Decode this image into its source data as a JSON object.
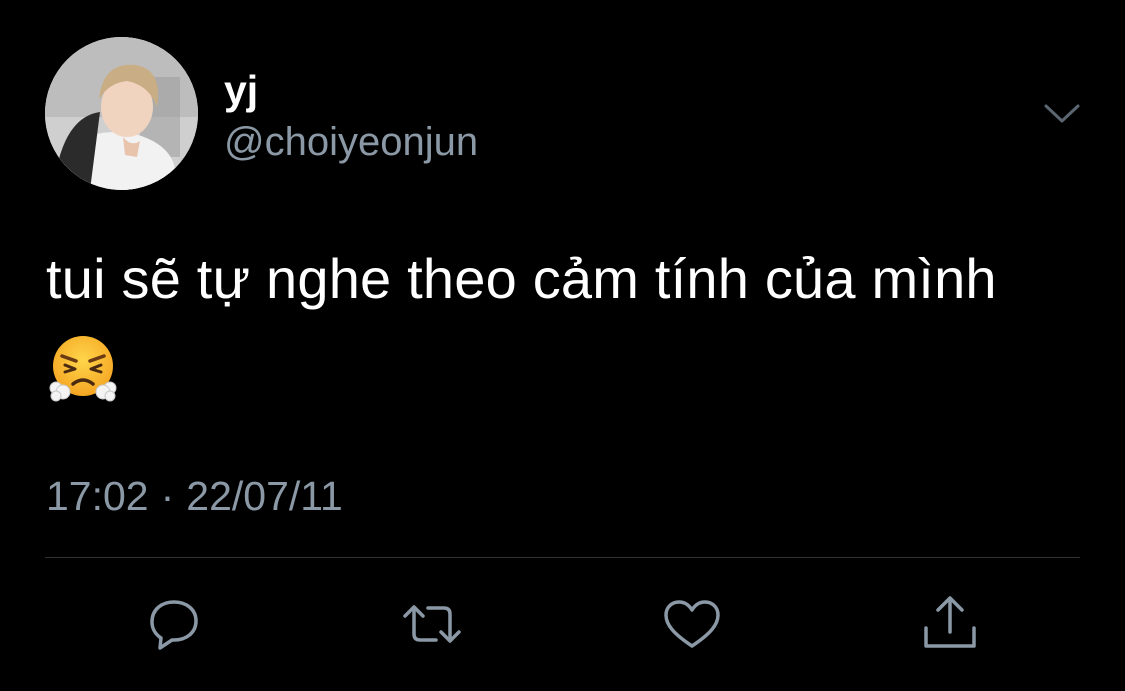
{
  "tweet": {
    "author": {
      "display_name": "yj",
      "handle": "@choiyeonjun"
    },
    "text": "tui sẽ tự nghe theo cảm tính của mình",
    "emoji": "😤",
    "time": "17:02",
    "separator": "·",
    "date": "22/07/11"
  },
  "icons": {
    "menu": "chevron-down-icon",
    "reply": "reply-icon",
    "retweet": "retweet-icon",
    "like": "heart-icon",
    "share": "share-icon"
  },
  "colors": {
    "background": "#000000",
    "text": "#ffffff",
    "secondary_text": "#8b98a5",
    "divider": "#2f3336"
  }
}
